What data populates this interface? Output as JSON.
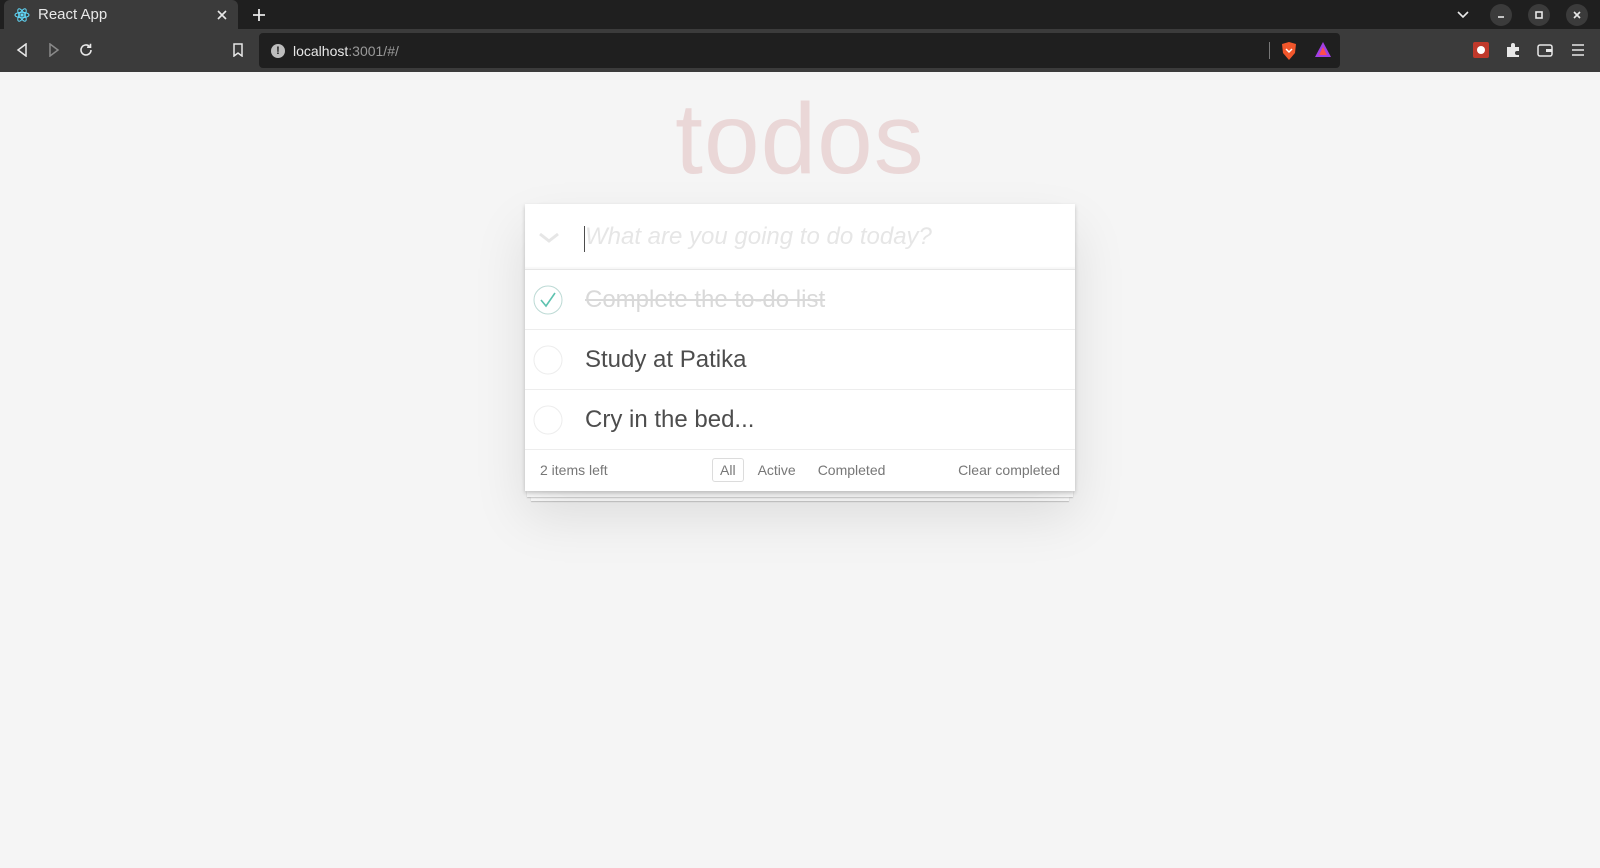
{
  "browser": {
    "tab_title": "React App",
    "url_host": "localhost",
    "url_path": ":3001/#/",
    "icons": [
      "react-favicon",
      "close-icon",
      "plus-icon",
      "chevron-down-icon",
      "minimize-icon",
      "maximize-icon",
      "close-window-icon",
      "back-icon",
      "forward-icon",
      "reload-icon",
      "bookmark-icon",
      "info-icon",
      "brave-shield-icon",
      "brave-rewards-icon",
      "extension-icon",
      "puzzle-icon",
      "wallet-icon",
      "menu-icon"
    ]
  },
  "app": {
    "title": "todos",
    "new_todo_placeholder": "What are you going to do today?",
    "new_todo_value": "",
    "todos": [
      {
        "text": "Complete the to-do list",
        "completed": true
      },
      {
        "text": "Study at Patika",
        "completed": false
      },
      {
        "text": "Cry in the bed...",
        "completed": false
      }
    ],
    "footer": {
      "items_left": "2 items left",
      "filters": [
        "All",
        "Active",
        "Completed"
      ],
      "selected_filter": "All",
      "clear_completed": "Clear completed"
    }
  },
  "colors": {
    "check_done": "#5dc2af",
    "title": "#eaeaea"
  }
}
